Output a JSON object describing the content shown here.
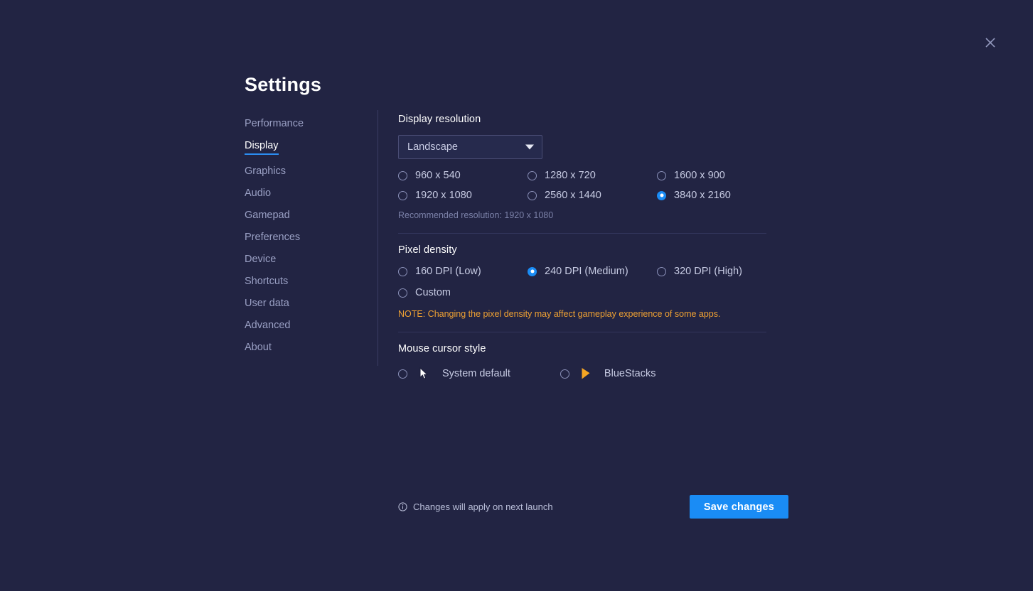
{
  "window": {
    "title": "Settings",
    "close_icon": "close-icon"
  },
  "sidebar": {
    "items": [
      {
        "label": "Performance",
        "active": false
      },
      {
        "label": "Display",
        "active": true
      },
      {
        "label": "Graphics",
        "active": false
      },
      {
        "label": "Audio",
        "active": false
      },
      {
        "label": "Gamepad",
        "active": false
      },
      {
        "label": "Preferences",
        "active": false
      },
      {
        "label": "Device",
        "active": false
      },
      {
        "label": "Shortcuts",
        "active": false
      },
      {
        "label": "User data",
        "active": false
      },
      {
        "label": "Advanced",
        "active": false
      },
      {
        "label": "About",
        "active": false
      }
    ]
  },
  "display_resolution": {
    "section_title": "Display resolution",
    "orientation_select": {
      "value": "Landscape",
      "caret_icon": "chevron-down-icon"
    },
    "options": [
      {
        "label": "960 x 540",
        "checked": false
      },
      {
        "label": "1280 x 720",
        "checked": false
      },
      {
        "label": "1600 x 900",
        "checked": false
      },
      {
        "label": "1920 x 1080",
        "checked": false
      },
      {
        "label": "2560 x 1440",
        "checked": false
      },
      {
        "label": "3840 x 2160",
        "checked": true
      }
    ],
    "recommended_text": "Recommended resolution: 1920 x 1080"
  },
  "pixel_density": {
    "section_title": "Pixel density",
    "options": [
      {
        "label": "160 DPI (Low)",
        "checked": false
      },
      {
        "label": "240 DPI (Medium)",
        "checked": true
      },
      {
        "label": "320 DPI (High)",
        "checked": false
      },
      {
        "label": "Custom",
        "checked": false
      }
    ],
    "note": "NOTE: Changing the pixel density may affect gameplay experience of some apps."
  },
  "mouse_cursor_style": {
    "section_title": "Mouse cursor style",
    "options": [
      {
        "label": "System default",
        "checked": false,
        "icon": "system-arrow-cursor-icon"
      },
      {
        "label": "BlueStacks",
        "checked": true,
        "icon": "bluestacks-arrow-cursor-icon"
      }
    ]
  },
  "footer": {
    "info_icon": "info-icon",
    "note": "Changes will apply on next launch",
    "save_label": "Save changes"
  },
  "colors": {
    "background": "#222443",
    "accent_blue": "#1a8cf5",
    "note_orange": "#efa133",
    "cursor_orange": "#f5a623",
    "text_primary": "#ffffff",
    "text_secondary": "#c7cbe3",
    "text_muted": "#7b81a8",
    "sidebar_text": "#9aa0c4",
    "divider": "#33365c"
  }
}
